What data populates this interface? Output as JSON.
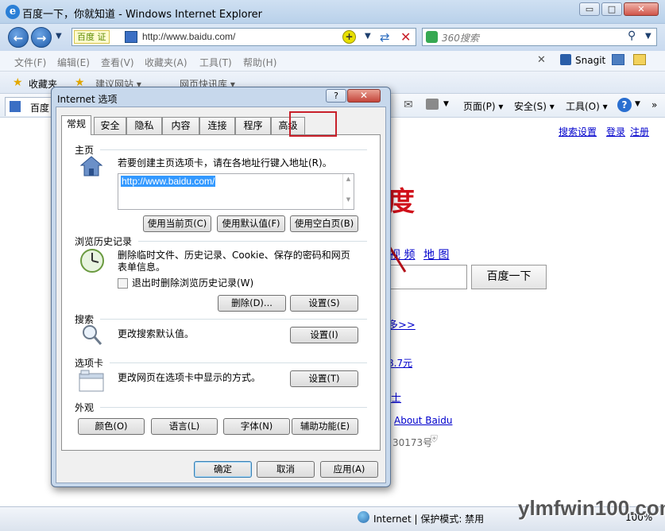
{
  "window": {
    "title": "百度一下，你就知道 - Windows Internet Explorer",
    "ie_logo": "e",
    "minimize": "▭",
    "maximize": "□",
    "close": "✕"
  },
  "addressbar": {
    "tag": "百度 证",
    "url": "http://www.baidu.com/",
    "search_placeholder": "360搜索"
  },
  "menubar": [
    "文件(F)",
    "编辑(E)",
    "查看(V)",
    "收藏夹(A)",
    "工具(T)",
    "帮助(H)"
  ],
  "menubar_right": {
    "snagit": "Snagit"
  },
  "favbar": {
    "favorites": "收藏夹",
    "suggested": "建议网站 ▾",
    "webslice": "网页快讯库 ▾"
  },
  "cmdbar": {
    "tab_label": "百度",
    "page": "页面(P) ▾",
    "safety": "安全(S) ▾",
    "tools": "工具(O) ▾"
  },
  "baidu_page": {
    "links_top": [
      "搜索设置",
      "登录",
      "注册"
    ],
    "logo_fragment": "度",
    "nav_fragments": [
      "视 频",
      "地 图"
    ],
    "button": "百度一下",
    "more": "多>>",
    "price": "8.7元",
    "shi": "士",
    "about": "About Baidu",
    "icp": "30173号"
  },
  "statusbar": {
    "zone": "Internet | 保护模式: 禁用",
    "zoom": "100%"
  },
  "watermark": "ylmfwin100.com",
  "dialog": {
    "title": "Internet 选项",
    "help": "?",
    "close": "✕",
    "tabs": [
      "常规",
      "安全",
      "隐私",
      "内容",
      "连接",
      "程序",
      "高级"
    ],
    "home": {
      "title": "主页",
      "desc": "若要创建主页选项卡，请在各地址行键入地址(R)。",
      "url": "http://www.baidu.com/",
      "btn_current": "使用当前页(C)",
      "btn_default": "使用默认值(F)",
      "btn_blank": "使用空白页(B)"
    },
    "history": {
      "title": "浏览历史记录",
      "desc": "删除临时文件、历史记录、Cookie、保存的密码和网页表单信息。",
      "checkbox": "退出时删除浏览历史记录(W)",
      "btn_delete": "删除(D)...",
      "btn_settings": "设置(S)"
    },
    "search": {
      "title": "搜索",
      "desc": "更改搜索默认值。",
      "btn_settings": "设置(I)"
    },
    "tabsec": {
      "title": "选项卡",
      "desc": "更改网页在选项卡中显示的方式。",
      "btn_settings": "设置(T)"
    },
    "appearance": {
      "title": "外观",
      "btn_colors": "颜色(O)",
      "btn_languages": "语言(L)",
      "btn_fonts": "字体(N)",
      "btn_access": "辅助功能(E)"
    },
    "footer": {
      "ok": "确定",
      "cancel": "取消",
      "apply": "应用(A)"
    }
  }
}
